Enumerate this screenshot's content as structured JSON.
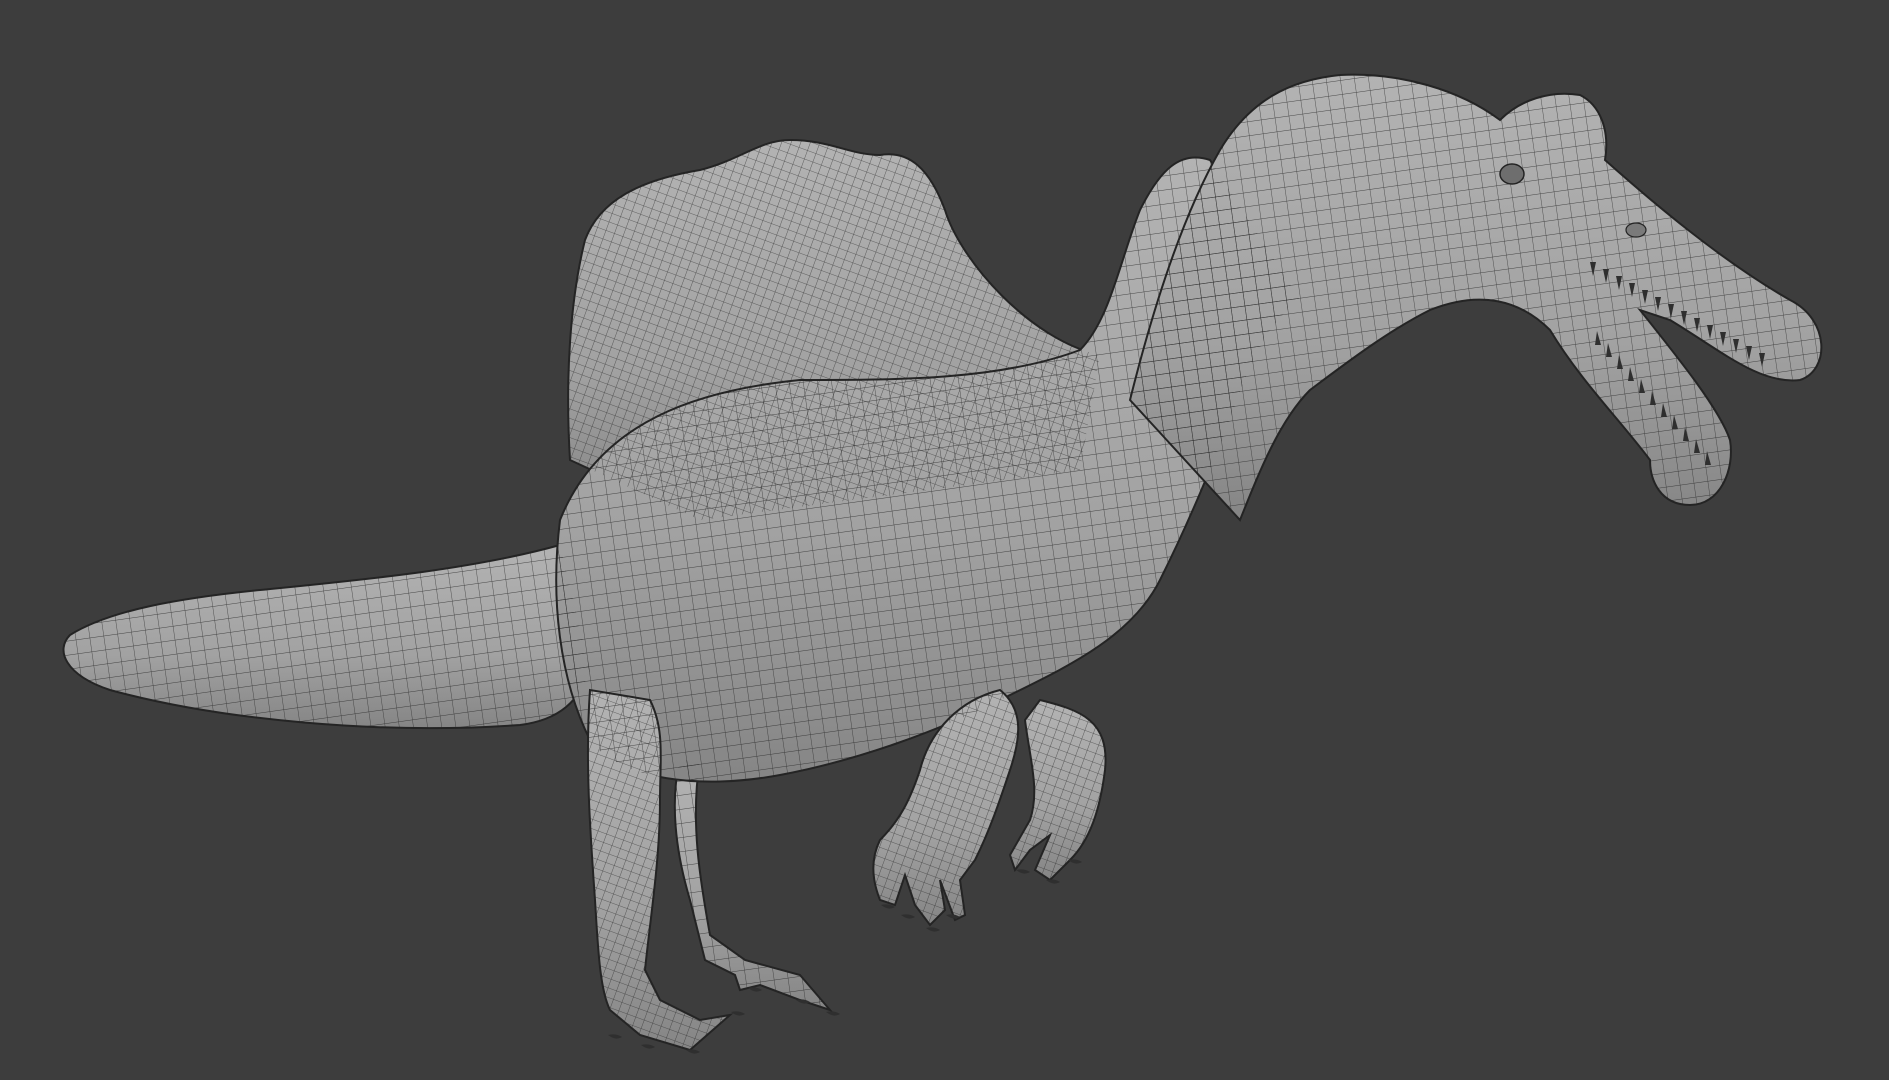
{
  "viewport": {
    "background_color": "#3d3d3d",
    "shading": "solid",
    "overlay": "wireframe"
  },
  "model": {
    "subject": "spinosaurus",
    "surface_color": "#a2a2a2",
    "surface_light_color": "#b3b3b3",
    "surface_shadow_color": "#858585",
    "wire_color": "#242424",
    "claw_color": "#2f2f2f"
  }
}
